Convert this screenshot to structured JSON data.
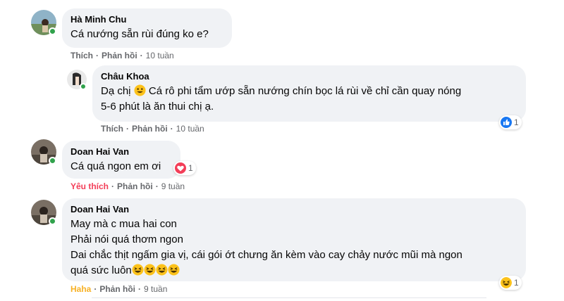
{
  "comments": [
    {
      "author": "Hà Minh Chu",
      "text_lines": [
        "Cá nướng sẵn rùi đúng ko e?"
      ],
      "actions": {
        "like": "Thích",
        "reply": "Phản hồi",
        "time": "10 tuần"
      }
    },
    {
      "author": "Châu Khoa",
      "text_lines": [
        "Dạ chị",
        "Cá rô phi tẩm ướp sẵn nướng chín bọc lá rùi về chỉ cần quay nóng",
        "5-6 phút là ăn thui chị ạ."
      ],
      "actions": {
        "like": "Thích",
        "reply": "Phản hồi",
        "time": "10 tuần"
      },
      "reaction": {
        "icon": "like-reaction-icon",
        "count": "1"
      }
    },
    {
      "author": "Doan Hai Van",
      "text_lines": [
        "Cá quá ngon em ơi"
      ],
      "actions": {
        "like": "Yêu thích",
        "reply": "Phản hồi",
        "time": "9 tuần"
      },
      "reaction": {
        "icon": "love-reaction-icon",
        "count": "1"
      }
    },
    {
      "author": "Doan Hai Van",
      "text_lines": [
        "May mà c mua hai con",
        "Phải nói quá thơm ngon",
        "Dai chắc thịt ngấm gia vị, cái gói ớt chưng ăn kèm vào cay chảy nước mũi mà ngon",
        "quá sức luôn"
      ],
      "actions": {
        "like": "Haha",
        "reply": "Phản hồi",
        "time": "9 tuần"
      },
      "reaction": {
        "icon": "haha-reaction-icon",
        "count": "1"
      }
    }
  ],
  "colors": {
    "bubble": "#f0f2f5",
    "meta_text": "#65676b",
    "love_label": "#f33e58",
    "haha_label": "#f7b125",
    "like_blue": "#1877f2",
    "online": "#31a24c"
  }
}
